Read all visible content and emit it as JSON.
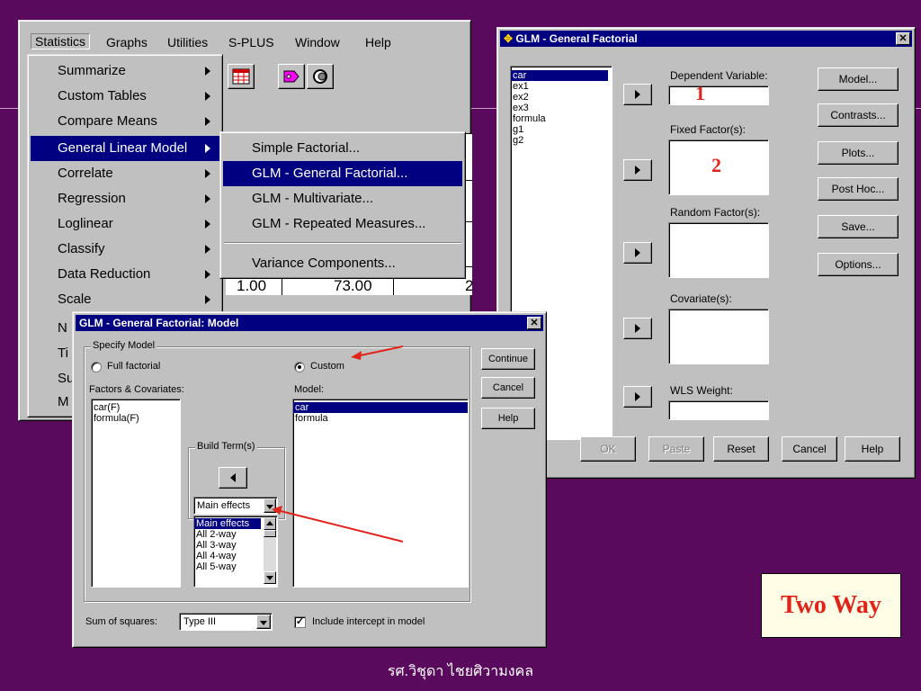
{
  "spss_menu": {
    "menubar": [
      {
        "label": "Statistics"
      },
      {
        "label": "Graphs"
      },
      {
        "label": "Utilities"
      },
      {
        "label": "S-PLUS"
      },
      {
        "label": "Window"
      },
      {
        "label": "Help"
      }
    ],
    "statistics_items": [
      {
        "label": "Summarize",
        "submenu": true
      },
      {
        "label": "Custom Tables",
        "submenu": true
      },
      {
        "label": "Compare Means",
        "submenu": true
      },
      {
        "label": "General Linear Model",
        "submenu": true,
        "highlighted": true
      },
      {
        "label": "Correlate",
        "submenu": true
      },
      {
        "label": "Regression",
        "submenu": true
      },
      {
        "label": "Loglinear",
        "submenu": true
      },
      {
        "label": "Classify",
        "submenu": true
      },
      {
        "label": "Data Reduction",
        "submenu": true
      },
      {
        "label": "Scale",
        "submenu": true
      },
      {
        "label": "N"
      },
      {
        "label": "Ti"
      },
      {
        "label": "Su"
      },
      {
        "label": "M"
      }
    ],
    "glm_submenu": [
      {
        "label": "Simple Factorial..."
      },
      {
        "label": "GLM - General Factorial...",
        "highlighted": true
      },
      {
        "label": "GLM - Multivariate..."
      },
      {
        "label": "GLM - Repeated Measures..."
      },
      {
        "label": "Variance Components..."
      }
    ],
    "data_cell_1": "1.00",
    "data_cell_2": "73.00",
    "data_cell_3": "2"
  },
  "glm_dialog": {
    "title": "GLM - General Factorial",
    "variables": [
      "car",
      "ex1",
      "ex2",
      "ex3",
      "formula",
      "g1",
      "g2"
    ],
    "selected_variable": "car",
    "dependent_label": "Dependent Variable:",
    "fixed_label": "Fixed Factor(s):",
    "random_label": "Random Factor(s):",
    "covariate_label": "Covariate(s):",
    "wls_label": "WLS Weight:",
    "side_buttons": [
      "Model...",
      "Contrasts...",
      "Plots...",
      "Post Hoc...",
      "Save...",
      "Options..."
    ],
    "bottom_buttons": [
      "OK",
      "Paste",
      "Reset",
      "Cancel",
      "Help"
    ],
    "marker_1": "1",
    "marker_2": "2"
  },
  "model_dialog": {
    "title": "GLM - General Factorial: Model",
    "specify_model_label": "Specify Model",
    "full_factorial_label": "Full factorial",
    "custom_label": "Custom",
    "custom_selected": true,
    "factors_label": "Factors & Covariates:",
    "factors": [
      "car(F)",
      "formula(F)"
    ],
    "model_label": "Model:",
    "model_terms": [
      "car",
      "formula"
    ],
    "selected_model_term": "car",
    "build_term_label": "Build Term(s)",
    "build_term_value": "Main effects",
    "build_term_options": [
      "Main effects",
      "All 2-way",
      "All 3-way",
      "All 4-way",
      "All 5-way"
    ],
    "buttons": [
      "Continue",
      "Cancel",
      "Help"
    ],
    "sum_of_squares_label": "Sum of squares:",
    "sum_of_squares_value": "Type III",
    "include_intercept_label": "Include intercept in model",
    "include_intercept_checked": true
  },
  "slide": {
    "callout": "Two Way",
    "footer": "รศ.วิชุดา ไชยศิวามงคล",
    "arrow_color": "#e2231a",
    "background": "#5a0a5c",
    "selection_color": "#000080"
  }
}
